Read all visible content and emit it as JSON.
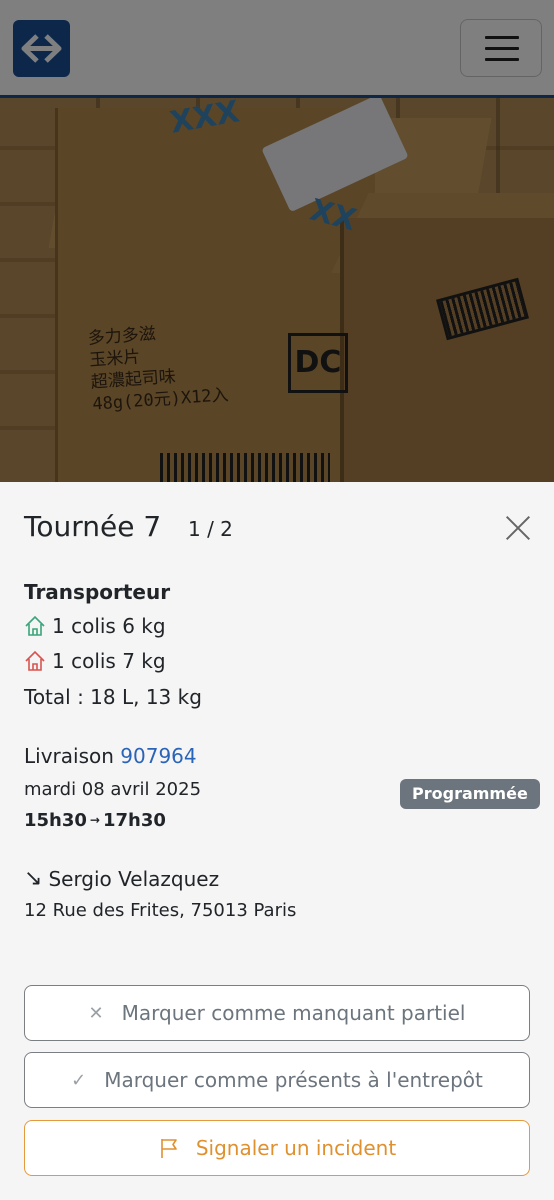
{
  "colors": {
    "brand": "#1a4e96",
    "link": "#2a64b8",
    "pickup_icon": "#3aa57a",
    "delivery_icon": "#d9534f",
    "badge_bg": "#6c757d",
    "incident": "#e0912f"
  },
  "header": {
    "logo_icon": "double-arrow-logo-icon",
    "menu_icon": "hamburger-icon"
  },
  "sheet": {
    "title": "Tournée 7",
    "counter": "1 / 2",
    "carrier_label": "Transporteur",
    "pickup": "1 colis 6 kg",
    "delivery": "1 colis 7 kg",
    "total": "Total : 18 L, 13 kg",
    "delivery_label": "Livraison",
    "delivery_id": "907964",
    "date": "mardi 08 avril 2025",
    "time_start": "15h30",
    "time_end": "17h30",
    "status": "Programmée",
    "recipient": "Sergio Velazquez",
    "address": "12 Rue des Frites, 75013 Paris"
  },
  "actions": {
    "missing_partial": "Marquer comme manquant partiel",
    "present_warehouse": "Marquer comme présents à l'entrepôt",
    "report_incident": "Signaler un incident"
  }
}
